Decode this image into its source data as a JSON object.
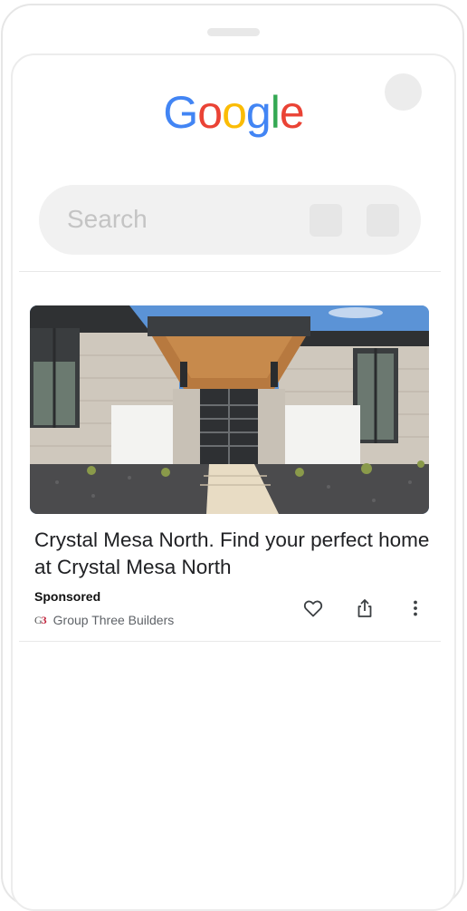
{
  "header": {
    "logo_letters": [
      {
        "char": "G",
        "color": "#4285F4"
      },
      {
        "char": "o",
        "color": "#EA4335"
      },
      {
        "char": "o",
        "color": "#FBBC05"
      },
      {
        "char": "g",
        "color": "#4285F4"
      },
      {
        "char": "l",
        "color": "#34A853"
      },
      {
        "char": "e",
        "color": "#EA4335"
      }
    ]
  },
  "search": {
    "placeholder": "Search"
  },
  "card": {
    "image_icon": "house-photo",
    "headline": "Crystal Mesa North. Find your perfect home at Crystal Mesa North",
    "sponsored_label": "Sponsored",
    "advertiser_logo_text": "G",
    "advertiser_logo_accent": "3",
    "advertiser_name": "Group Three Builders",
    "actions": {
      "like_icon": "heart-icon",
      "share_icon": "share-icon",
      "more_icon": "more-vert-icon"
    }
  },
  "colors": {
    "text_primary": "#202124",
    "text_secondary": "#5f6368",
    "placeholder_gray": "#ececec"
  }
}
